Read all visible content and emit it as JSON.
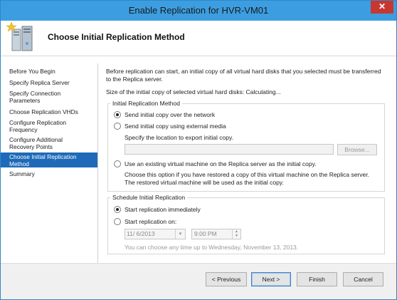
{
  "window": {
    "title": "Enable Replication for HVR-VM01",
    "close_glyph": "✕"
  },
  "header": {
    "title": "Choose Initial Replication Method",
    "icon": "replication-server-icon"
  },
  "nav": {
    "items": [
      {
        "label": "Before You Begin"
      },
      {
        "label": "Specify Replica Server"
      },
      {
        "label": "Specify Connection Parameters"
      },
      {
        "label": "Choose Replication VHDs"
      },
      {
        "label": "Configure Replication Frequency"
      },
      {
        "label": "Configure Additional Recovery Points"
      },
      {
        "label": "Choose Initial Replication Method",
        "selected": true
      },
      {
        "label": "Summary"
      }
    ]
  },
  "content": {
    "intro": "Before replication can start, an initial copy of all virtual hard disks that you selected must be transferred to the Replica server.",
    "size_line": "Size of the initial copy of selected virtual hard disks:  Calculating...",
    "method_group": {
      "title": "Initial Replication Method",
      "opt_network": "Send initial copy over the network",
      "opt_external": "Send initial copy using external media",
      "external_hint": "Specify the location to export initial copy.",
      "path_value": "",
      "browse_label": "Browse...",
      "opt_existing": "Use an existing virtual machine on the Replica server as the initial copy.",
      "existing_hint": "Choose this option if you have restored a copy of this virtual machine on the Replica server. The restored virtual machine will be used as the initial copy.",
      "selected": "network"
    },
    "schedule_group": {
      "title": "Schedule Initial Replication",
      "opt_immediate": "Start replication immediately",
      "opt_on": "Start replication on:",
      "date_value": "11/ 6/2013",
      "time_value": "9:00 PM",
      "hint": "You can choose any time up to Wednesday, November 13, 2013.",
      "selected": "immediate"
    }
  },
  "footer": {
    "previous": "< Previous",
    "next": "Next >",
    "finish": "Finish",
    "cancel": "Cancel"
  },
  "colors": {
    "titlebar": "#3c9ee0",
    "nav_selected": "#1e6ab8",
    "close": "#c7362f"
  }
}
